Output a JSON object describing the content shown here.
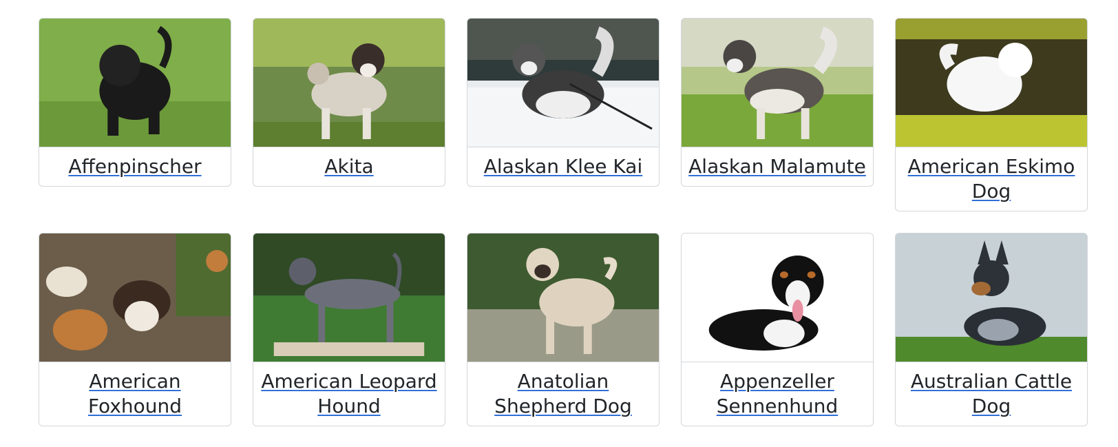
{
  "breeds": [
    {
      "name": "Affenpinscher",
      "image": "black-dog-on-grass-photo"
    },
    {
      "name": "Akita",
      "image": "akita-standing-photo"
    },
    {
      "name": "Alaskan Klee Kai",
      "image": "klee-kai-in-snow-photo"
    },
    {
      "name": "Alaskan Malamute",
      "image": "malamute-on-grass-photo"
    },
    {
      "name": "American Eskimo Dog",
      "image": "white-eskimo-dog-photo"
    },
    {
      "name": "American Foxhound",
      "image": "foxhounds-group-photo"
    },
    {
      "name": "American Leopard Hound",
      "image": "leopard-hound-standing-photo"
    },
    {
      "name": "Anatolian Shepherd Dog",
      "image": "anatolian-shepherd-photo"
    },
    {
      "name": "Appenzeller Sennenhund",
      "image": "appenzeller-lying-photo"
    },
    {
      "name": "Australian Cattle Dog",
      "image": "cattle-dog-lying-photo"
    }
  ],
  "colors": {
    "link_underline": "#2f6fd6",
    "card_border": "#d3d6da"
  }
}
